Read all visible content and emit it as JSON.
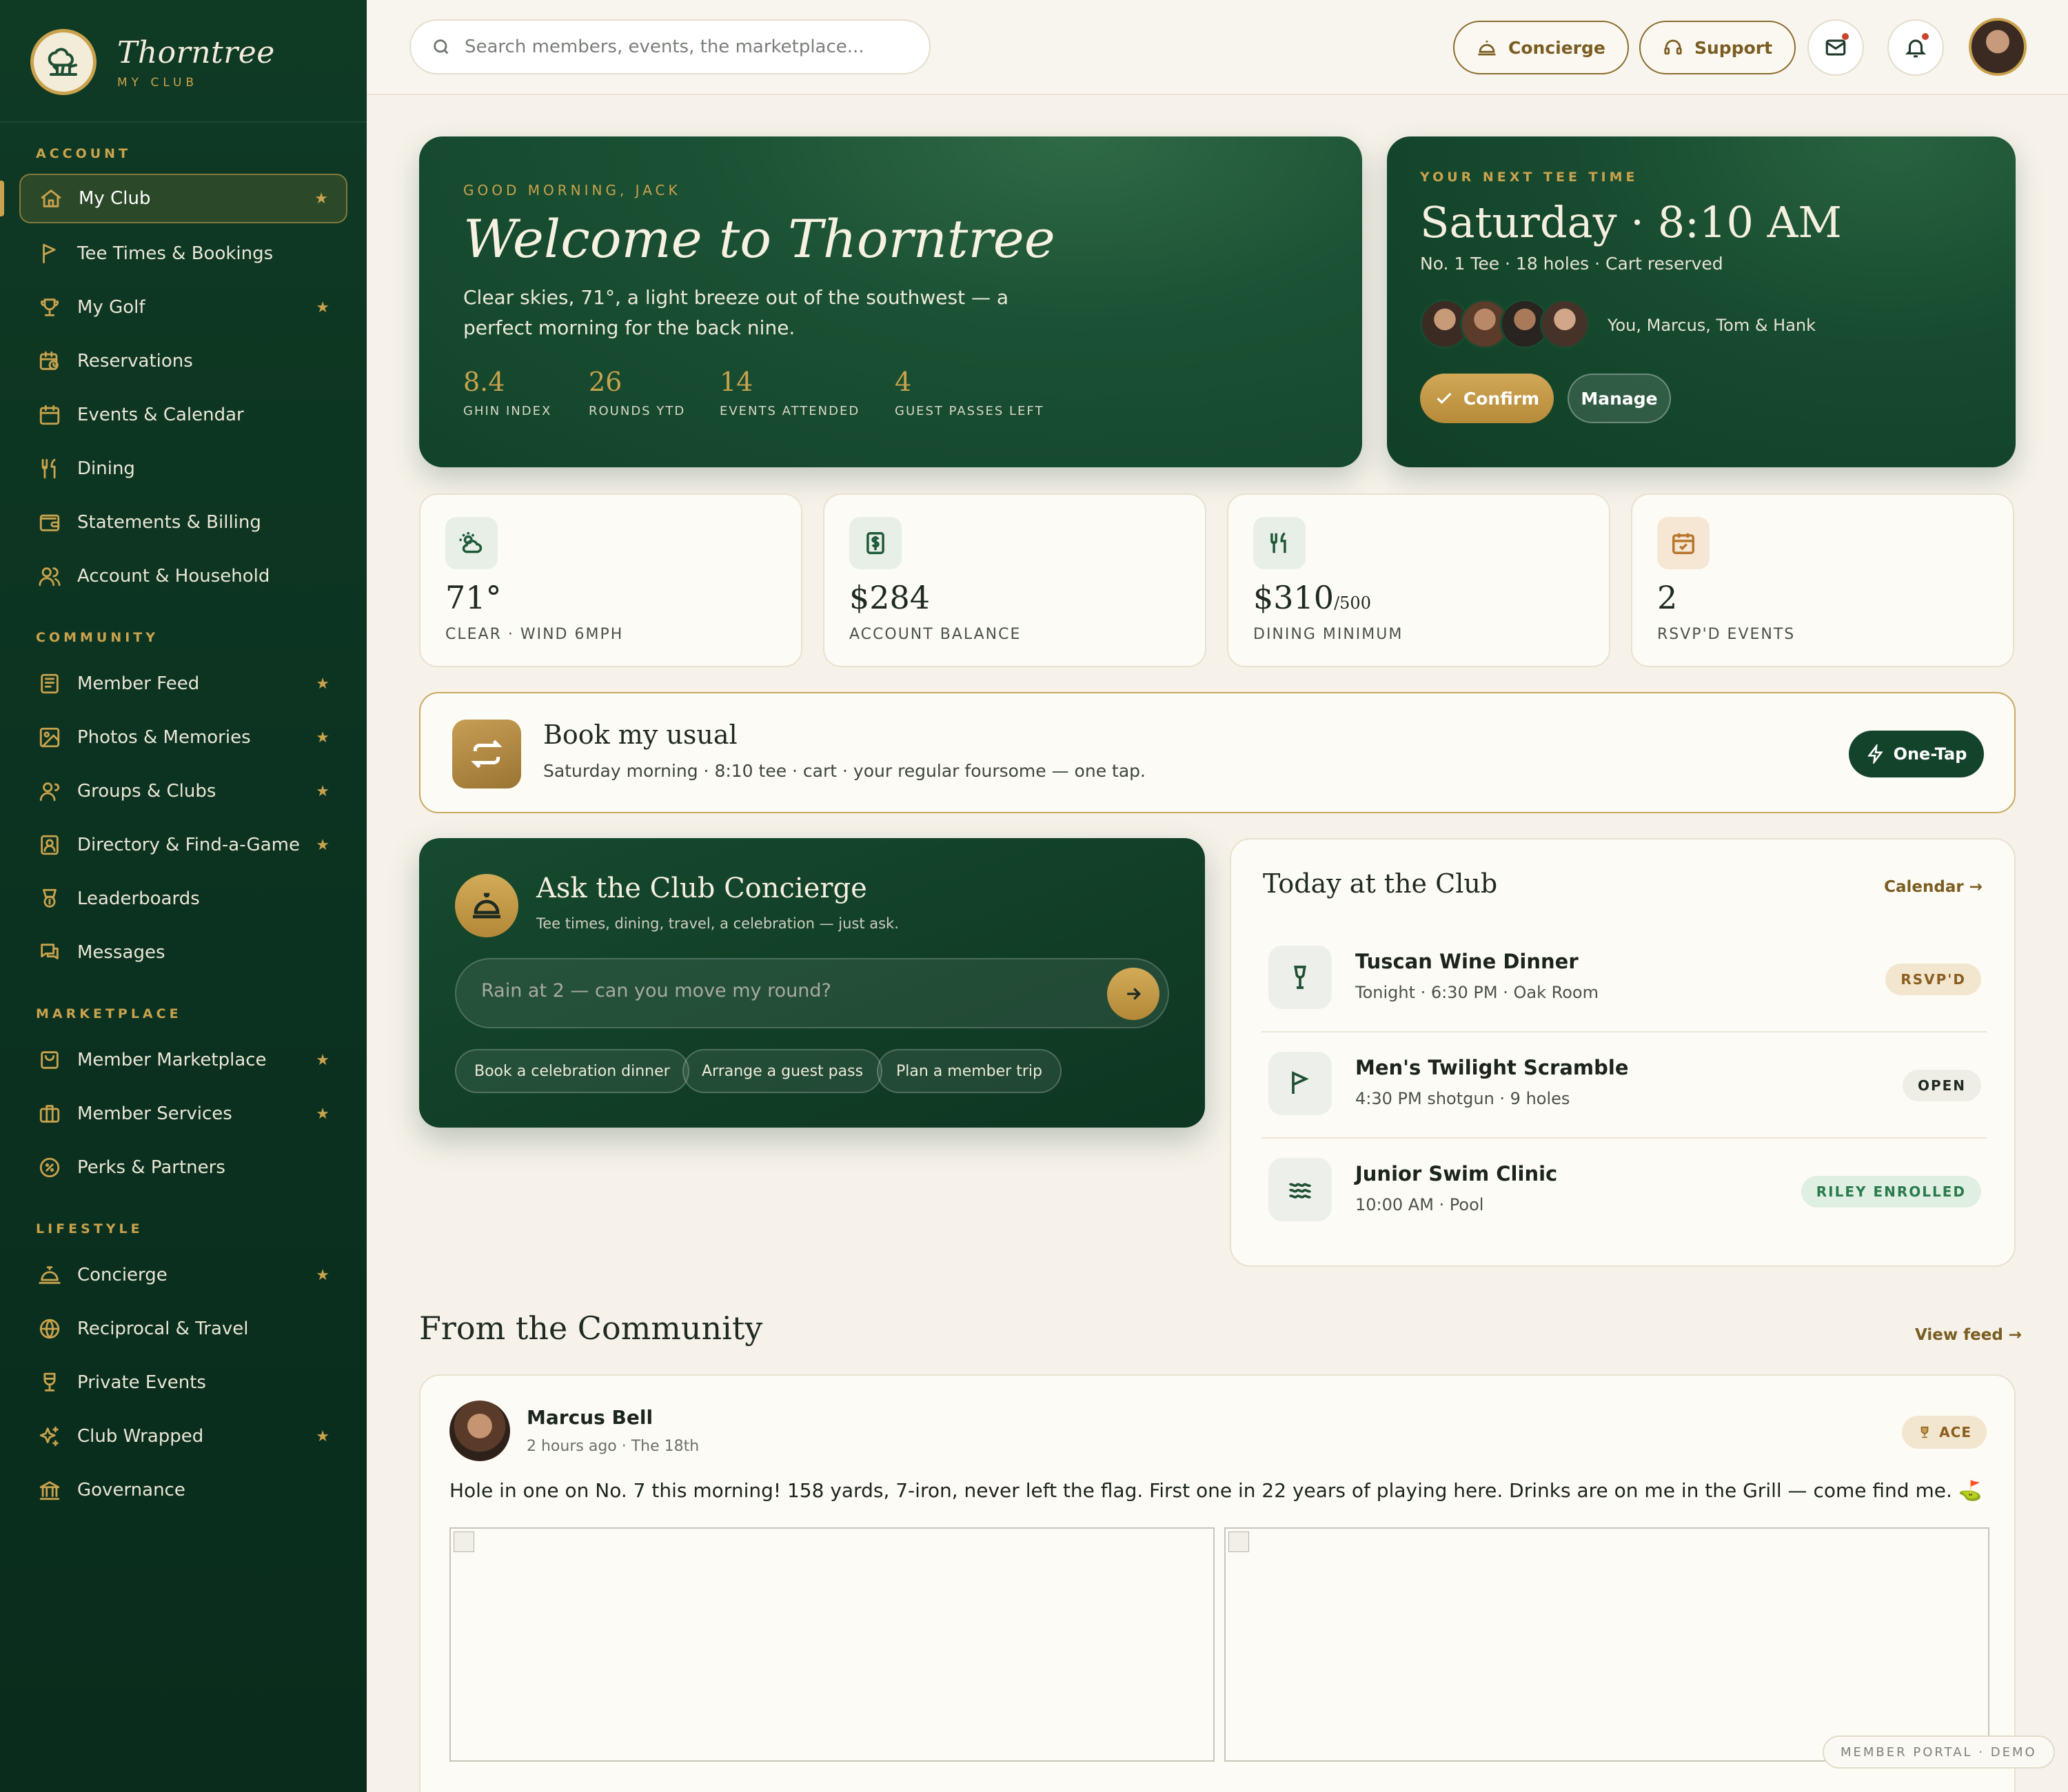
{
  "brand": {
    "name": "Thorntree",
    "subtitle": "MY CLUB"
  },
  "sidebar": {
    "sections": [
      {
        "label": "ACCOUNT",
        "items": [
          {
            "label": "My Club",
            "icon": "home-icon",
            "starred": true,
            "active": true
          },
          {
            "label": "Tee Times & Bookings",
            "icon": "flag-icon",
            "starred": false
          },
          {
            "label": "My Golf",
            "icon": "trophy-icon",
            "starred": true
          },
          {
            "label": "Reservations",
            "icon": "calendar-clock-icon",
            "starred": false
          },
          {
            "label": "Events & Calendar",
            "icon": "calendar-icon",
            "starred": false
          },
          {
            "label": "Dining",
            "icon": "utensils-icon",
            "starred": false
          },
          {
            "label": "Statements & Billing",
            "icon": "wallet-icon",
            "starred": false
          },
          {
            "label": "Account & Household",
            "icon": "users-icon",
            "starred": false
          }
        ]
      },
      {
        "label": "COMMUNITY",
        "items": [
          {
            "label": "Member Feed",
            "icon": "newspaper-icon",
            "starred": true
          },
          {
            "label": "Photos & Memories",
            "icon": "image-icon",
            "starred": true
          },
          {
            "label": "Groups & Clubs",
            "icon": "group-icon",
            "starred": true
          },
          {
            "label": "Directory & Find-a-Game",
            "icon": "contact-card-icon",
            "starred": true
          },
          {
            "label": "Leaderboards",
            "icon": "award-icon",
            "starred": false
          },
          {
            "label": "Messages",
            "icon": "chat-icon",
            "starred": false
          }
        ]
      },
      {
        "label": "MARKETPLACE",
        "items": [
          {
            "label": "Member Marketplace",
            "icon": "shopping-bag-icon",
            "starred": true
          },
          {
            "label": "Member Services",
            "icon": "briefcase-icon",
            "starred": true
          },
          {
            "label": "Perks & Partners",
            "icon": "badge-percent-icon",
            "starred": false
          }
        ]
      },
      {
        "label": "LIFESTYLE",
        "items": [
          {
            "label": "Concierge",
            "icon": "service-bell-icon",
            "starred": true
          },
          {
            "label": "Reciprocal & Travel",
            "icon": "globe-icon",
            "starred": false
          },
          {
            "label": "Private Events",
            "icon": "glass-icon",
            "starred": false
          },
          {
            "label": "Club Wrapped",
            "icon": "sparkles-icon",
            "starred": true
          },
          {
            "label": "Governance",
            "icon": "landmark-icon",
            "starred": false
          }
        ]
      }
    ],
    "star_glyph": "★"
  },
  "topbar": {
    "search_placeholder": "Search members, events, the marketplace...",
    "concierge_label": "Concierge",
    "support_label": "Support"
  },
  "hero": {
    "greeting": "GOOD MORNING, JACK",
    "title": "Welcome to Thorntree",
    "description": "Clear skies, 71°, a light breeze out of the southwest — a perfect morning for the back nine.",
    "stats": [
      {
        "value": "8.4",
        "label": "GHIN INDEX"
      },
      {
        "value": "26",
        "label": "ROUNDS YTD"
      },
      {
        "value": "14",
        "label": "EVENTS ATTENDED"
      },
      {
        "value": "4",
        "label": "GUEST PASSES LEFT"
      }
    ]
  },
  "tee_time": {
    "label": "YOUR NEXT TEE TIME",
    "time": "Saturday · 8:10 AM",
    "detail": "No. 1 Tee · 18 holes · Cart reserved",
    "players": "You, Marcus, Tom & Hank",
    "confirm_label": "Confirm",
    "manage_label": "Manage"
  },
  "stat_cards": [
    {
      "value": "71°",
      "suffix": "",
      "label": "CLEAR · WIND 6MPH",
      "icon": "sun-cloud-icon"
    },
    {
      "value": "$284",
      "suffix": "",
      "label": "ACCOUNT BALANCE",
      "icon": "receipt-icon"
    },
    {
      "value": "$310",
      "suffix": "/500",
      "label": "DINING MINIMUM",
      "icon": "utensils-icon"
    },
    {
      "value": "2",
      "suffix": "",
      "label": "RSVP'D EVENTS",
      "icon": "calendar-check-icon"
    }
  ],
  "usual": {
    "title": "Book my usual",
    "subtitle": "Saturday morning · 8:10 tee · cart · your regular foursome — one tap.",
    "button_label": "One-Tap"
  },
  "concierge": {
    "title": "Ask the Club Concierge",
    "subtitle": "Tee times, dining, travel, a celebration — just ask.",
    "input_placeholder": "Rain at 2 — can you move my round?",
    "chips": [
      "Book a celebration dinner",
      "Arrange a guest pass",
      "Plan a member trip"
    ]
  },
  "today": {
    "title": "Today at the Club",
    "link_label": "Calendar →",
    "events": [
      {
        "name": "Tuscan Wine Dinner",
        "when": "Tonight · 6:30 PM · Oak Room",
        "badge": "RSVP'D",
        "badge_style": "gold",
        "icon": "wine-glass-icon"
      },
      {
        "name": "Men's Twilight Scramble",
        "when": "4:30 PM shotgun · 9 holes",
        "badge": "OPEN",
        "badge_style": "gray",
        "icon": "flag-icon"
      },
      {
        "name": "Junior Swim Clinic",
        "when": "10:00 AM · Pool",
        "badge": "RILEY ENROLLED",
        "badge_style": "green",
        "icon": "waves-icon"
      }
    ]
  },
  "community": {
    "title": "From the Community",
    "link_label": "View feed →",
    "post": {
      "author": "Marcus Bell",
      "meta": "2 hours ago · The 18th",
      "badge": "ACE",
      "text": "Hole in one on No. 7 this morning! 158 yards, 7-iron, never left the flag. First one in 22 years of playing here. Drinks are on me in the Grill — come find me. ⛳"
    }
  },
  "footer_tag": "MEMBER PORTAL · DEMO",
  "colors": {
    "sidebar": "#0f3a24",
    "accent_gold": "#c9a24d",
    "background": "#f6f2e9",
    "card": "#fdfbf5",
    "dark_green": "#14432b"
  }
}
